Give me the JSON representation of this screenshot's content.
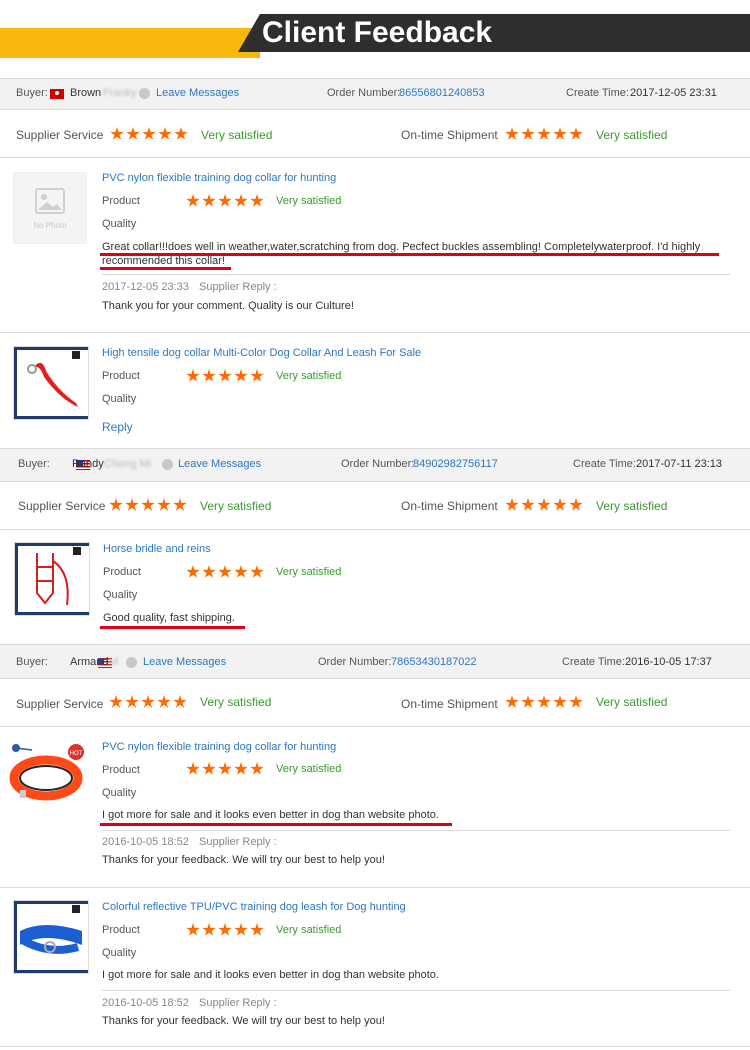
{
  "banner": {
    "title": "Client Feedback"
  },
  "labels": {
    "buyer": "Buyer:",
    "leave_messages": "Leave Messages",
    "order_number": "Order Number:",
    "create_time": "Create Time:",
    "supplier_service": "Supplier Service",
    "ontime_shipment": "On-time Shipment",
    "very_satisfied": "Very satisfied",
    "product": "Product",
    "quality": "Quality",
    "supplier_reply": "Supplier Reply :",
    "reply": "Reply",
    "no_photo": "No Photo"
  },
  "orders": [
    {
      "buyer_name": "Brown",
      "buyer_hidden": "Franky",
      "flag": "HK",
      "order_number": "86556801240853",
      "create_time": "2017-12-05 23:31",
      "items": [
        {
          "title": "PVC nylon flexible training dog collar for hunting",
          "thumb": "no-photo",
          "review": "Great collar!!!does well in weather,water,scratching from dog. Pecfect buckles assembling! Completelywaterproof. I'd highly recommended this collar!",
          "reply_time": "2017-12-05 23:33",
          "reply_text": "Thank you for your comment. Quality is our Culture!"
        },
        {
          "title": "High tensile dog collar Multi-Color Dog Collar And Leash For Sale",
          "thumb": "leash-red"
        }
      ]
    },
    {
      "buyer_name": "Randy",
      "buyer_hidden": "Chong Mi",
      "flag": "MY",
      "order_number": "84902982756117",
      "create_time": "2017-07-11 23:13",
      "items": [
        {
          "title": "Horse bridle and reins",
          "thumb": "bridle",
          "review": "Good quality, fast shipping."
        }
      ]
    },
    {
      "buyer_name": "Armand",
      "buyer_hidden": "M",
      "flag": "US",
      "order_number": "78653430187022",
      "create_time": "2016-10-05 17:37",
      "items": [
        {
          "title": "PVC nylon flexible training dog collar for hunting",
          "thumb": "collar-orange",
          "review": "I got more for sale and it looks even better in dog than website photo.",
          "reply_time": "2016-10-05 18:52",
          "reply_text": "Thanks for your feedback. We will try our best to help you!"
        },
        {
          "title": "Colorful reflective TPU/PVC training dog leash for Dog hunting",
          "thumb": "leash-blue",
          "review": "I got more for sale and it looks even better in dog than website photo.",
          "reply_time": "2016-10-05 18:52",
          "reply_text": "Thanks for your feedback. We will try our best to help you!"
        }
      ]
    }
  ],
  "colors": {
    "banner_yellow": "#f8b810",
    "banner_dark": "#2e2e2e",
    "star": "#ff6a00",
    "link": "#2d77c2",
    "satisfied": "#3a9b2e",
    "underline": "#e00014"
  },
  "rating": {
    "stars": 5,
    "max": 5
  }
}
